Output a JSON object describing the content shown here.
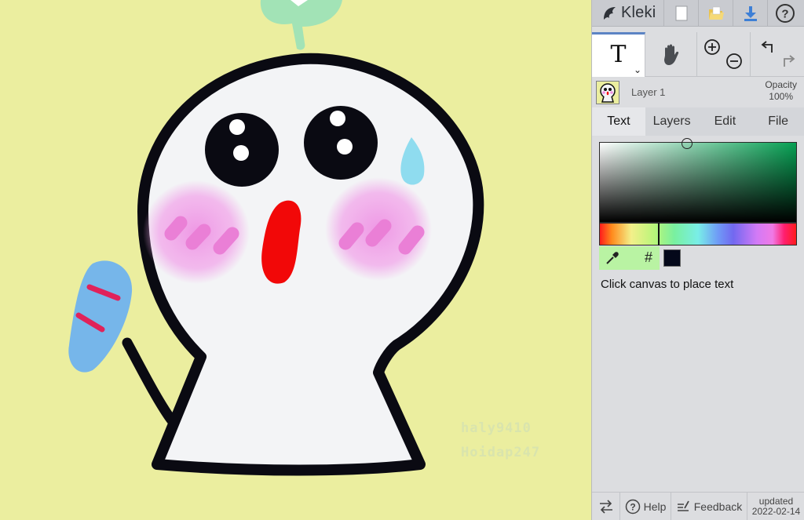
{
  "app": {
    "name": "Kleki",
    "accent": "#5c84c4"
  },
  "topbar": {
    "icons": [
      "kleki-logo-icon",
      "new-image-icon",
      "open-folder-icon",
      "download-icon",
      "help-icon"
    ]
  },
  "tools": {
    "active": "text-tool",
    "items": [
      "text-tool-icon",
      "hand-tool-icon",
      "zoom-in-icon",
      "zoom-out-icon",
      "undo-icon",
      "redo-icon"
    ]
  },
  "layer": {
    "name": "Layer 1",
    "opacity_label": "Opacity",
    "opacity_value": "100%"
  },
  "tabs": [
    {
      "label": "Text",
      "active": true
    },
    {
      "label": "Layers",
      "active": false
    },
    {
      "label": "Edit",
      "active": false
    },
    {
      "label": "File",
      "active": false
    }
  ],
  "color": {
    "picked": "#04081a",
    "hue": "#06a053",
    "hash_label": "#"
  },
  "hint": "Click canvas to place text",
  "bottombar": {
    "help": "Help",
    "feedback": "Feedback",
    "updated_label": "updated",
    "updated_date": "2022-02-14"
  },
  "canvas": {
    "background": "#ebee9f",
    "watermark_1": "haly9410",
    "watermark_2": "Hoidap247"
  }
}
